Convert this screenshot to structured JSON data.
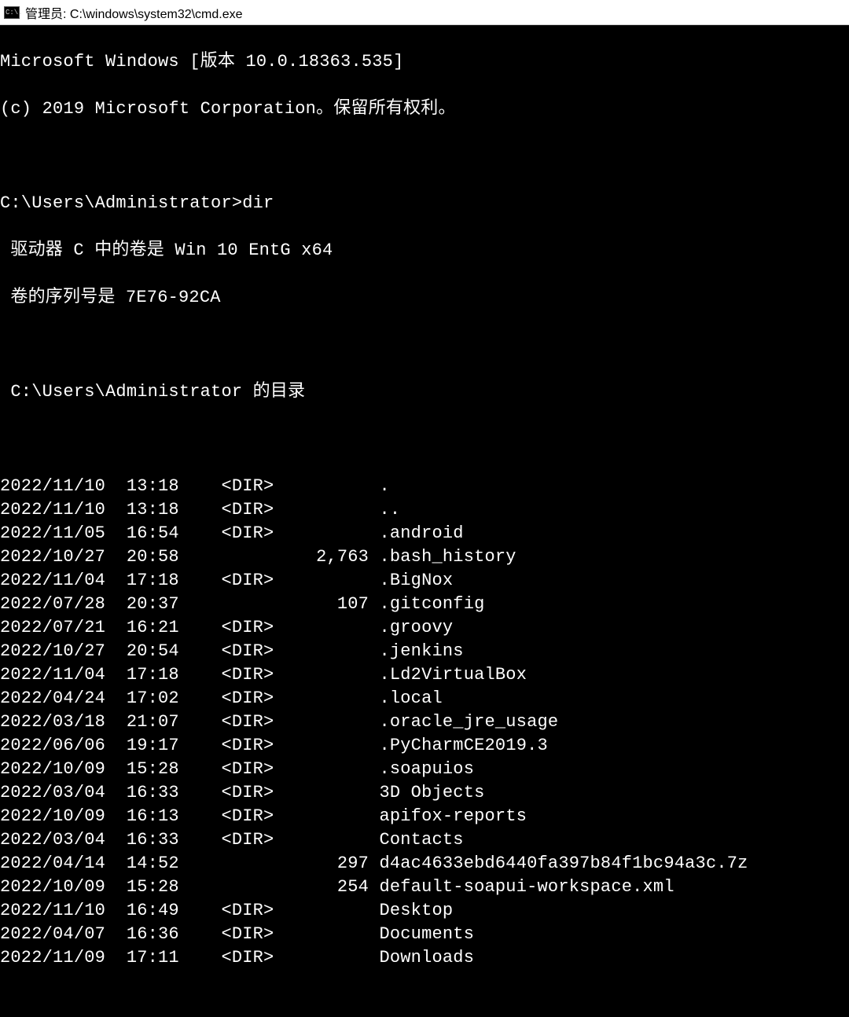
{
  "window": {
    "title": "管理员: C:\\windows\\system32\\cmd.exe",
    "icon_glyph": "C:\\."
  },
  "header": {
    "line1": "Microsoft Windows [版本 10.0.18363.535]",
    "line2": "(c) 2019 Microsoft Corporation。保留所有权利。"
  },
  "prompt": {
    "path": "C:\\Users\\Administrator>",
    "command": "dir"
  },
  "volume": {
    "line1": " 驱动器 C 中的卷是 Win 10 EntG x64",
    "line2": " 卷的序列号是 7E76-92CA"
  },
  "dir_of": " C:\\Users\\Administrator 的目录",
  "entries": [
    {
      "date": "2022/11/10",
      "time": "13:18",
      "type": "<DIR>",
      "size": "",
      "name": "."
    },
    {
      "date": "2022/11/10",
      "time": "13:18",
      "type": "<DIR>",
      "size": "",
      "name": ".."
    },
    {
      "date": "2022/11/05",
      "time": "16:54",
      "type": "<DIR>",
      "size": "",
      "name": ".android"
    },
    {
      "date": "2022/10/27",
      "time": "20:58",
      "type": "",
      "size": "2,763",
      "name": ".bash_history"
    },
    {
      "date": "2022/11/04",
      "time": "17:18",
      "type": "<DIR>",
      "size": "",
      "name": ".BigNox"
    },
    {
      "date": "2022/07/28",
      "time": "20:37",
      "type": "",
      "size": "107",
      "name": ".gitconfig"
    },
    {
      "date": "2022/07/21",
      "time": "16:21",
      "type": "<DIR>",
      "size": "",
      "name": ".groovy"
    },
    {
      "date": "2022/10/27",
      "time": "20:54",
      "type": "<DIR>",
      "size": "",
      "name": ".jenkins"
    },
    {
      "date": "2022/11/04",
      "time": "17:18",
      "type": "<DIR>",
      "size": "",
      "name": ".Ld2VirtualBox"
    },
    {
      "date": "2022/04/24",
      "time": "17:02",
      "type": "<DIR>",
      "size": "",
      "name": ".local"
    },
    {
      "date": "2022/03/18",
      "time": "21:07",
      "type": "<DIR>",
      "size": "",
      "name": ".oracle_jre_usage"
    },
    {
      "date": "2022/06/06",
      "time": "19:17",
      "type": "<DIR>",
      "size": "",
      "name": ".PyCharmCE2019.3"
    },
    {
      "date": "2022/10/09",
      "time": "15:28",
      "type": "<DIR>",
      "size": "",
      "name": ".soapuios"
    },
    {
      "date": "2022/03/04",
      "time": "16:33",
      "type": "<DIR>",
      "size": "",
      "name": "3D Objects"
    },
    {
      "date": "2022/10/09",
      "time": "16:13",
      "type": "<DIR>",
      "size": "",
      "name": "apifox-reports"
    },
    {
      "date": "2022/03/04",
      "time": "16:33",
      "type": "<DIR>",
      "size": "",
      "name": "Contacts"
    },
    {
      "date": "2022/04/14",
      "time": "14:52",
      "type": "",
      "size": "297",
      "name": "d4ac4633ebd6440fa397b84f1bc94a3c.7z"
    },
    {
      "date": "2022/10/09",
      "time": "15:28",
      "type": "",
      "size": "254",
      "name": "default-soapui-workspace.xml"
    },
    {
      "date": "2022/11/10",
      "time": "16:49",
      "type": "<DIR>",
      "size": "",
      "name": "Desktop"
    },
    {
      "date": "2022/04/07",
      "time": "16:36",
      "type": "<DIR>",
      "size": "",
      "name": "Documents"
    },
    {
      "date": "2022/11/09",
      "time": "17:11",
      "type": "<DIR>",
      "size": "",
      "name": "Downloads"
    }
  ]
}
